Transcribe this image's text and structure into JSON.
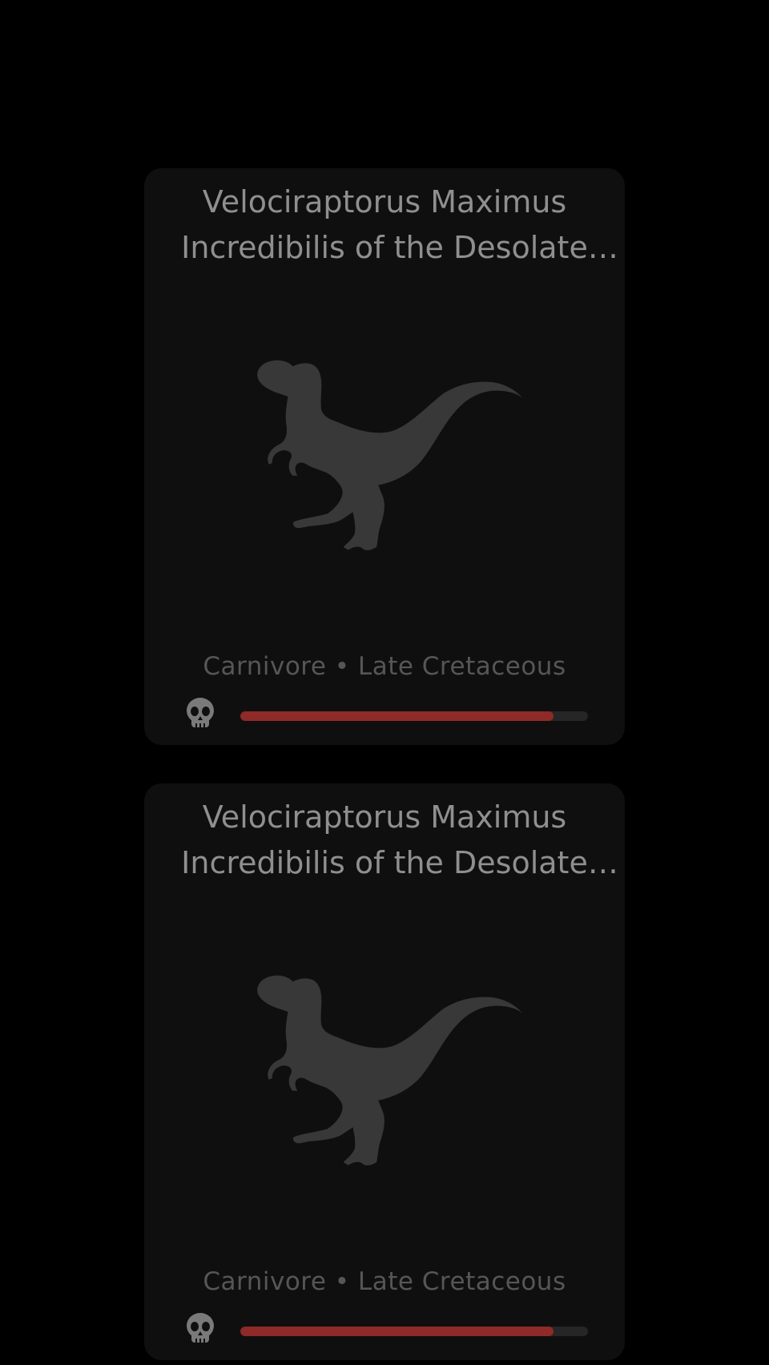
{
  "cards": [
    {
      "title": "Velociraptorus Maximus Incredibilis of the Desolate Empire",
      "meta": "Carnivore • Late Cretaceous",
      "icon": "raptor-silhouette-icon",
      "danger_icon": "skull-icon",
      "danger_level": 0.9
    },
    {
      "title": "Velociraptorus Maximus Incredibilis of the Desolate Empire",
      "meta": "Carnivore • Late Cretaceous",
      "icon": "raptor-silhouette-icon",
      "danger_icon": "skull-icon",
      "danger_level": 0.9
    }
  ],
  "colors": {
    "background": "#000000",
    "card": "#0f0f0f",
    "title": "#8f8f8f",
    "meta": "#565656",
    "silhouette": "#383838",
    "danger": "#8e2a27",
    "track": "#262626"
  }
}
